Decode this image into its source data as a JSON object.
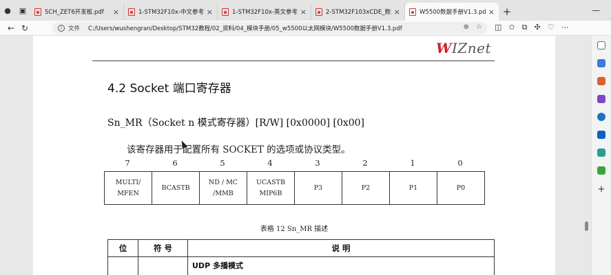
{
  "tabs": [
    {
      "title": "SCH_ZET6开发板.pdf",
      "active": false
    },
    {
      "title": "1-STM32F10x-中文参考手册",
      "active": false
    },
    {
      "title": "1-STM32F10x-英文参考手册",
      "active": false
    },
    {
      "title": "2-STM32F103xCDE_数据手册",
      "active": false
    },
    {
      "title": "W5500数据手册V1.3.pdf",
      "active": true
    }
  ],
  "address": {
    "label": "文件",
    "path": "C:/Users/wushengran/Desktop/STM32教程/02_资料/04_模块手册/05_w5500以太网模块/W5500数据手册V1.3.pdf"
  },
  "document": {
    "logo": "WIZnet",
    "section_title": "4.2 Socket 端口寄存器",
    "register_title": "Sn_MR（Socket n 模式寄存器）[R/W] [0x0000] [0x00]",
    "description": "该寄存器用于配置所有 SOCKET 的选项或协议类型。",
    "bit_numbers": [
      "7",
      "6",
      "5",
      "4",
      "3",
      "2",
      "1",
      "0"
    ],
    "bit_fields": [
      [
        "MULTI/",
        "MFEN"
      ],
      [
        "BCASTB"
      ],
      [
        "ND / MC",
        "/MMB"
      ],
      [
        "UCASTB",
        "MIP6B"
      ],
      [
        "P3"
      ],
      [
        "P2"
      ],
      [
        "P1"
      ],
      [
        "P0"
      ]
    ],
    "caption": "表格 12 Sn_MR 描述",
    "table_headers": {
      "bit": "位",
      "symbol": "符 号",
      "desc": "说 明"
    },
    "first_row_desc": "UDP 多播模式"
  }
}
